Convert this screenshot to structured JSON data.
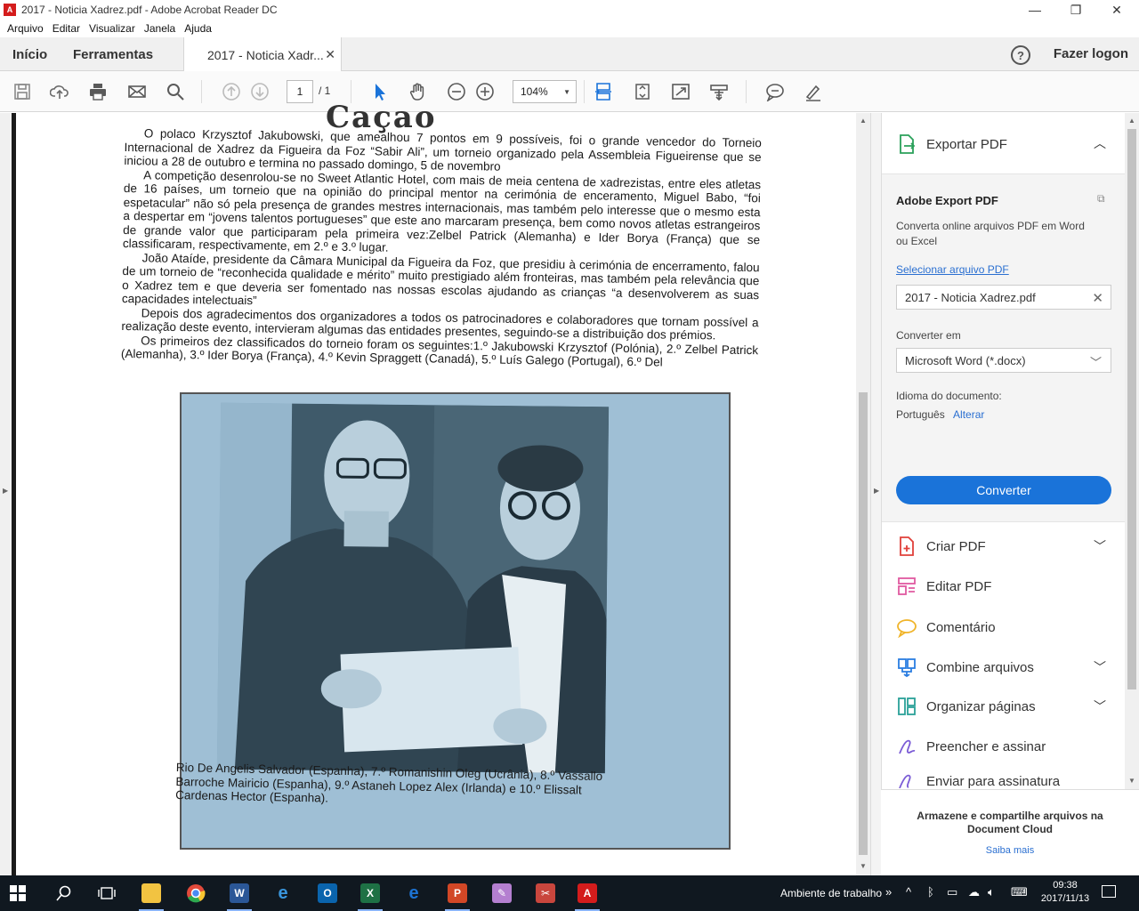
{
  "window": {
    "title": "2017 - Noticia Xadrez.pdf - Adobe Acrobat Reader DC",
    "minimize": "—",
    "restore": "❐",
    "close": "✕"
  },
  "menu": [
    "Arquivo",
    "Editar",
    "Visualizar",
    "Janela",
    "Ajuda"
  ],
  "tabs": {
    "home": "Início",
    "tools": "Ferramentas",
    "document": "2017 - Noticia Xadr...",
    "close_glyph": "✕",
    "help": "?",
    "login": "Fazer logon"
  },
  "toolbar": {
    "page_current": "1",
    "page_total": "/ 1",
    "zoom": "104%"
  },
  "document": {
    "heading_fragment": "Caçao",
    "paragraphs": [
      "O polaco Krzysztof Jakubowski, que amealhou 7 pontos em 9 possíveis, foi o grande vencedor do Torneio Internacional de Xadrez da Figueira da Foz “Sabir Ali”, um torneio organizado pela Assembleia Figueirense que se iniciou a 28 de outubro e termina no passado domingo, 5 de novembro",
      "A competição desenrolou-se no Sweet Atlantic Hotel, com mais de meia centena de xadrezistas, entre eles atletas de 16 países, um torneio que na opinião do principal mentor na cerimónia de enceramento, Miguel Babo, “foi espetacular” não só pela presença de grandes mestres internacionais, mas também pelo interesse que o mesmo esta a despertar em “jovens talentos portugueses” que este ano marcaram presença, bem como novos atletas estrangeiros de grande valor que participaram pela primeira vez:Zelbel Patrick (Alemanha) e Ider Borya (França) que se classificaram, respectivamente, em 2.º e 3.º lugar.",
      "João Ataíde, presidente da Câmara Municipal da Figueira da Foz, que presidiu à cerimónia de encerramento, falou de um torneio de “reconhecida qualidade e mérito” muito prestigiado além fronteiras, mas também pela relevância que o Xadrez tem e que deveria ser fomentado nas nossas escolas ajudando as crianças “a desenvolverem as suas capacidades intelectuais”",
      "Depois dos agradecimentos dos organizadores a todos os patrocinadores e colaboradores que tornam possível a realização deste evento, intervieram algumas das entidades presentes, seguindo-se a distribuição dos prémios.",
      "Os primeiros dez classificados do torneio foram os seguintes:1.º Jakubowski Krzysztof (Polónia), 2.º Zelbel Patrick (Alemanha), 3.º Ider Borya (França), 4.º Kevin Spraggett (Canadá), 5.º Luís Galego (Portugal), 6.º Del"
    ],
    "caption": "Rio De Angelis Salvador (Espanha), 7.º Romanishin Oleg (Ucrânia), 8.º Vassallo Barroche Mairicio (Espanha), 9.º Astaneh Lopez Alex (Irlanda) e 10.º Elissalt Cardenas Hector (Espanha)."
  },
  "right_panel": {
    "export_title": "Exportar PDF",
    "export_heading": "Adobe Export PDF",
    "export_desc": "Converta online arquivos PDF em Word ou Excel",
    "select_link": "Selecionar arquivo PDF",
    "selected_file": "2017 - Noticia Xadrez.pdf",
    "convert_to_label": "Converter em",
    "convert_to_value": "Microsoft Word (*.docx)",
    "language_label": "Idioma do documento:",
    "language_value": "Português",
    "language_change": "Alterar",
    "convert_button": "Converter",
    "tools": [
      {
        "label": "Criar PDF",
        "icon": "create-pdf-icon",
        "color": "#e0403a"
      },
      {
        "label": "Editar PDF",
        "icon": "edit-pdf-icon",
        "color": "#e05aa0"
      },
      {
        "label": "Comentário",
        "icon": "comment-icon",
        "color": "#f0b429"
      },
      {
        "label": "Combine arquivos",
        "icon": "combine-icon",
        "color": "#2a7de1"
      },
      {
        "label": "Organizar páginas",
        "icon": "organize-icon",
        "color": "#2aa198"
      },
      {
        "label": "Preencher e assinar",
        "icon": "sign-icon",
        "color": "#7b5cd6"
      },
      {
        "label": "Enviar para assinatura",
        "icon": "send-sign-icon",
        "color": "#7b5cd6"
      }
    ],
    "cloud_title": "Armazene e compartilhe arquivos na Document Cloud",
    "cloud_link": "Saiba mais"
  },
  "taskbar": {
    "desktop_label": "Ambiente de trabalho",
    "more": "»",
    "time": "09:38",
    "date": "2017/11/13"
  },
  "colors": {
    "accent": "#1a73d9",
    "photo_tint": "#9fbfd5"
  }
}
